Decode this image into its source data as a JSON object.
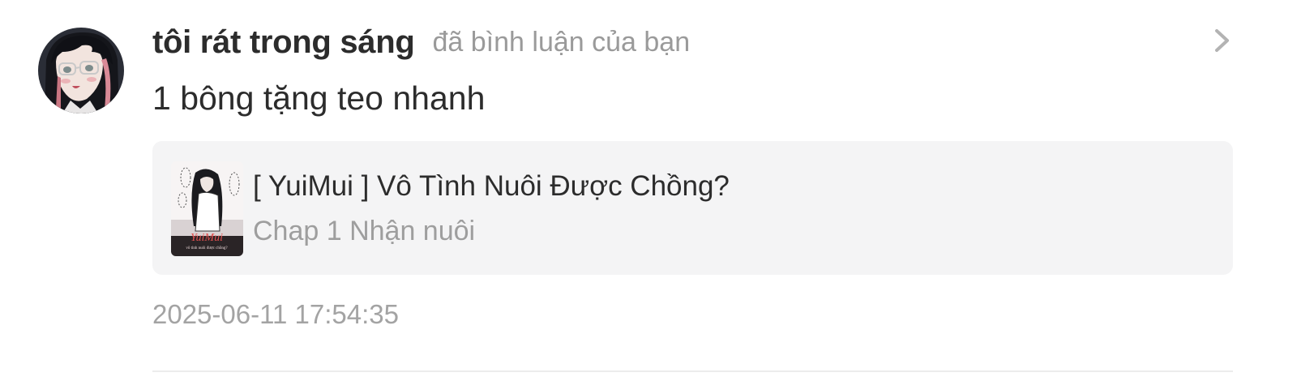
{
  "notification": {
    "username": "tôi rát trong sáng",
    "action_text": "đã bình luận của bạn",
    "comment": "1 bông tặng teo nhanh",
    "timestamp": "2025-06-11 17:54:35",
    "avatar_icon": "user-avatar-icon",
    "chevron_icon": "chevron-right-icon"
  },
  "story_card": {
    "title": "[ YuiMui ] Vô Tình Nuôi Được Chồng?",
    "chapter": "Chap 1 Nhận nuôi",
    "cover_title": "YuiMui",
    "cover_subtitle": "vô tình nuôi được chồng?"
  },
  "colors": {
    "username": "#2c2c2c",
    "secondary_text": "#9a9a9a",
    "card_background": "#f4f4f5",
    "divider": "#ececec"
  }
}
